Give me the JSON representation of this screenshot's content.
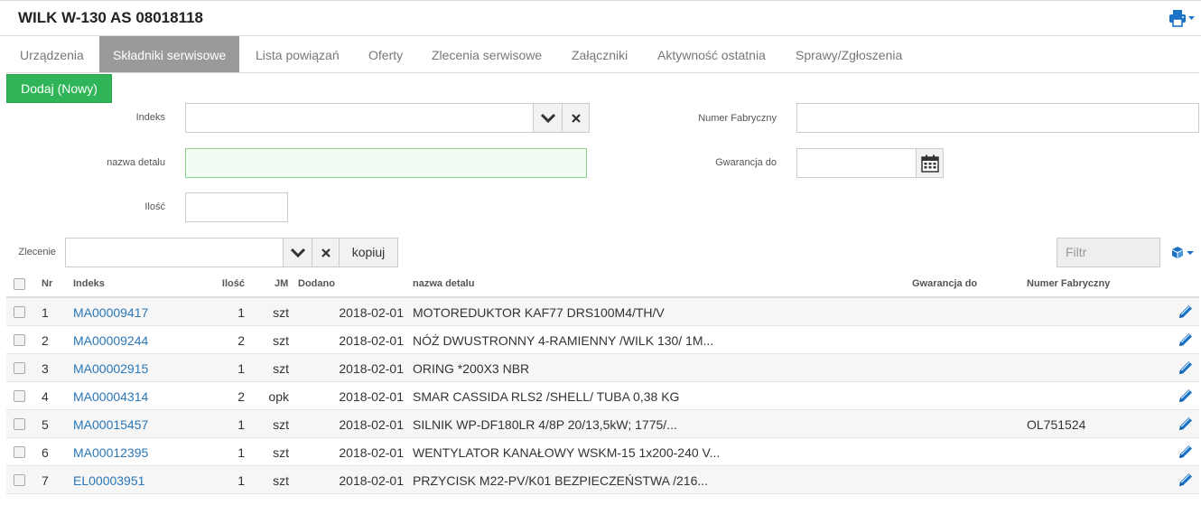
{
  "header": {
    "title": "WILK W-130 AS 08018118"
  },
  "tabs": [
    {
      "label": "Urządzenia"
    },
    {
      "label": "Składniki serwisowe"
    },
    {
      "label": "Lista powiązań"
    },
    {
      "label": "Oferty"
    },
    {
      "label": "Zlecenia serwisowe"
    },
    {
      "label": "Załączniki"
    },
    {
      "label": "Aktywność ostatnia"
    },
    {
      "label": "Sprawy/Zgłoszenia"
    }
  ],
  "toolbar": {
    "add_label": "Dodaj (Nowy)"
  },
  "form": {
    "indeks_label": "Indeks",
    "indeks_value": "",
    "nazwa_label": "nazwa detalu",
    "nazwa_value": "",
    "ilosc_label": "Ilość",
    "ilosc_value": "",
    "numer_label": "Numer Fabryczny",
    "numer_value": "",
    "gwarancja_label": "Gwarancja do",
    "gwarancja_value": ""
  },
  "zlecenie": {
    "label": "Zlecenie",
    "value": "",
    "copy_label": "kopiuj"
  },
  "filter": {
    "placeholder": "Filtr"
  },
  "table": {
    "columns": {
      "nr": "Nr",
      "indeks": "Indeks",
      "ilosc": "Ilość",
      "jm": "JM",
      "dodano": "Dodano",
      "nazwa": "nazwa detalu",
      "gwarancja": "Gwarancja do",
      "numer": "Numer Fabryczny"
    },
    "rows": [
      {
        "nr": "1",
        "indeks": "MA00009417",
        "ilosc": "1",
        "jm": "szt",
        "dodano": "2018-02-01",
        "nazwa": "MOTOREDUKTOR KAF77 DRS100M4/TH/V",
        "gwarancja": "",
        "numer": ""
      },
      {
        "nr": "2",
        "indeks": "MA00009244",
        "ilosc": "2",
        "jm": "szt",
        "dodano": "2018-02-01",
        "nazwa": "NÓŻ DWUSTRONNY 4-RAMIENNY /WILK 130/ 1M...",
        "gwarancja": "",
        "numer": ""
      },
      {
        "nr": "3",
        "indeks": "MA00002915",
        "ilosc": "1",
        "jm": "szt",
        "dodano": "2018-02-01",
        "nazwa": "ORING *200X3 NBR",
        "gwarancja": "",
        "numer": ""
      },
      {
        "nr": "4",
        "indeks": "MA00004314",
        "ilosc": "2",
        "jm": "opk",
        "dodano": "2018-02-01",
        "nazwa": "SMAR CASSIDA RLS2 /SHELL/ TUBA 0,38 KG",
        "gwarancja": "",
        "numer": ""
      },
      {
        "nr": "5",
        "indeks": "MA00015457",
        "ilosc": "1",
        "jm": "szt",
        "dodano": "2018-02-01",
        "nazwa": "SILNIK WP-DF180LR 4/8P 20/13,5kW; 1775/...",
        "gwarancja": "",
        "numer": "OL751524"
      },
      {
        "nr": "6",
        "indeks": "MA00012395",
        "ilosc": "1",
        "jm": "szt",
        "dodano": "2018-02-01",
        "nazwa": "WENTYLATOR KANAŁOWY WSKM-15 1x200-240 V...",
        "gwarancja": "",
        "numer": ""
      },
      {
        "nr": "7",
        "indeks": "EL00003951",
        "ilosc": "1",
        "jm": "szt",
        "dodano": "2018-02-01",
        "nazwa": "PRZYCISK M22-PV/K01 BEZPIECZEŃSTWA /216...",
        "gwarancja": "",
        "numer": ""
      }
    ]
  },
  "icons": {
    "print": "print-icon",
    "chevron": "chevron-down-icon",
    "clear": "close-icon",
    "calendar": "calendar-icon",
    "cube": "cube-icon",
    "edit": "pencil-icon"
  },
  "colors": {
    "primary_link": "#2a76b8",
    "add_button": "#2fb558",
    "active_tab": "#9a9a9a",
    "accent_icon": "#1a73c6"
  }
}
